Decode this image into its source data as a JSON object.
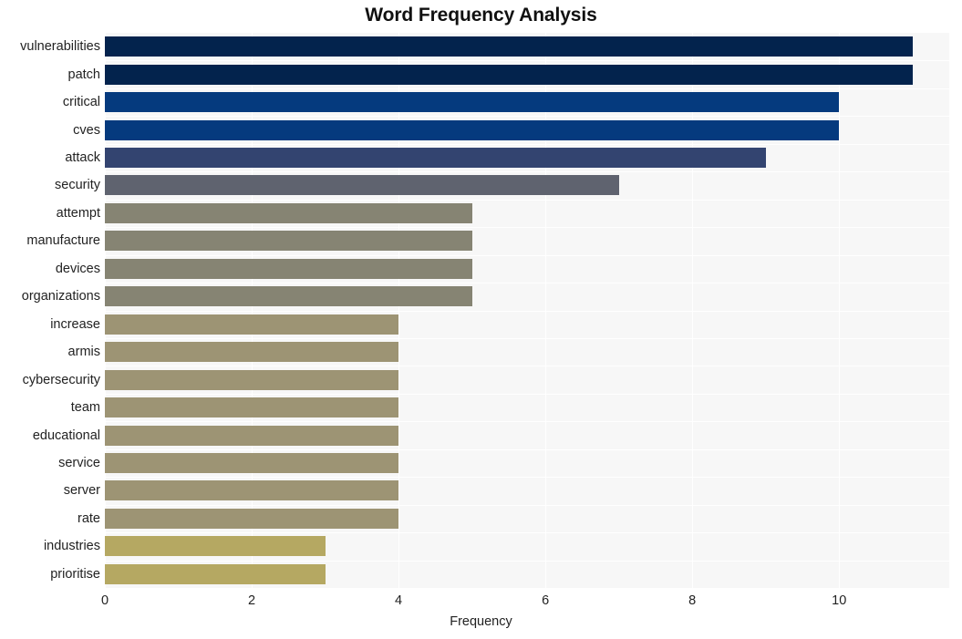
{
  "chart_data": {
    "type": "bar",
    "orientation": "horizontal",
    "title": "Word Frequency Analysis",
    "xlabel": "Frequency",
    "ylabel": "",
    "xlim": [
      0,
      11.5
    ],
    "xticks": [
      0,
      2,
      4,
      6,
      8,
      10
    ],
    "grid": true,
    "legend": "none",
    "categories": [
      "vulnerabilities",
      "patch",
      "critical",
      "cves",
      "attack",
      "security",
      "attempt",
      "manufacture",
      "devices",
      "organizations",
      "increase",
      "armis",
      "cybersecurity",
      "team",
      "educational",
      "service",
      "server",
      "rate",
      "industries",
      "prioritise"
    ],
    "values": [
      11,
      11,
      10,
      10,
      9,
      7,
      5,
      5,
      5,
      5,
      4,
      4,
      4,
      4,
      4,
      4,
      4,
      4,
      3,
      3
    ],
    "bar_colors": [
      "#03234d",
      "#03234d",
      "#053a7e",
      "#053a7e",
      "#334470",
      "#5f636f",
      "#868473",
      "#868473",
      "#868473",
      "#868473",
      "#9d9474",
      "#9d9474",
      "#9d9474",
      "#9d9474",
      "#9d9474",
      "#9d9474",
      "#9d9474",
      "#9d9474",
      "#b5a862",
      "#b5a862"
    ]
  },
  "style": {
    "plot_background": "#f7f7f7",
    "figure_background": "#ffffff",
    "gridline_color": "#ffffff",
    "text_color": "#222222",
    "title_color": "#111111"
  }
}
